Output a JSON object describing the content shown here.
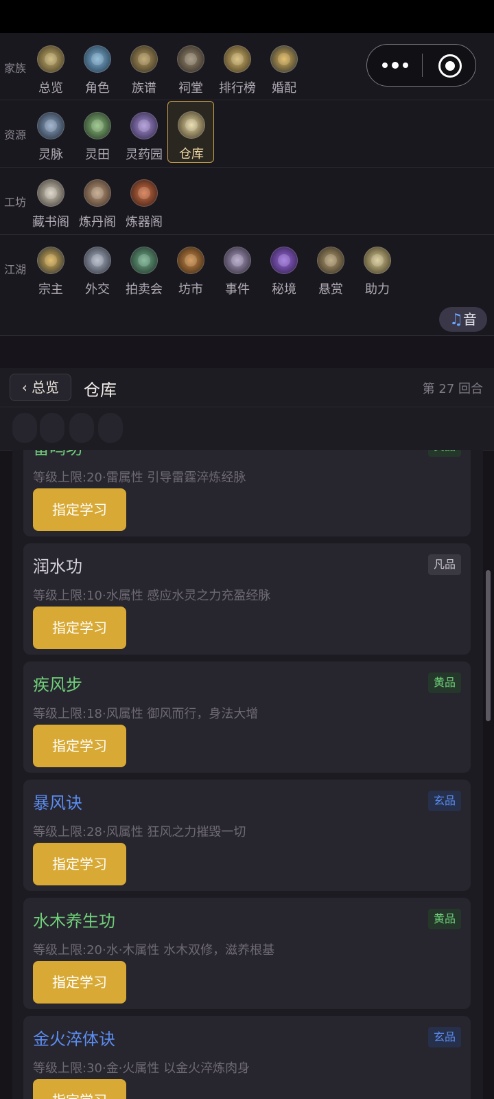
{
  "menu": {
    "rows": [
      {
        "label": "家族",
        "items": [
          "总览",
          "角色",
          "族谱",
          "祠堂",
          "排行榜",
          "婚配"
        ]
      },
      {
        "label": "资源",
        "items": [
          "灵脉",
          "灵田",
          "灵药园",
          "仓库"
        ]
      },
      {
        "label": "工坊",
        "items": [
          "藏书阁",
          "炼丹阁",
          "炼器阁"
        ]
      },
      {
        "label": "江湖",
        "items": [
          "宗主",
          "外交",
          "拍卖会",
          "坊市",
          "事件",
          "秘境",
          "悬赏",
          "助力"
        ]
      }
    ],
    "active_item": "仓库",
    "music_label": "音",
    "music_icon": "music-note-icon"
  },
  "header": {
    "back_label": "‹ 总览",
    "title": "仓库",
    "round": "第 27 回合"
  },
  "learn_label": "指定学习",
  "grade_colors": {
    "凡品": {
      "text": "#c9c5cf",
      "bg": "#3a3840",
      "name": "#d7d3dc"
    },
    "黄品": {
      "text": "#6fcf7a",
      "bg": "#25372a",
      "name": "#6fcf7a"
    },
    "玄品": {
      "text": "#5b8df2",
      "bg": "#26304a",
      "name": "#5b8df2"
    }
  },
  "techniques": [
    {
      "name": "雷鸣功",
      "grade": "黄品",
      "desc": "等级上限:20·雷属性  引导雷霆淬炼经脉"
    },
    {
      "name": "润水功",
      "grade": "凡品",
      "desc": "等级上限:10·水属性  感应水灵之力充盈经脉"
    },
    {
      "name": "疾风步",
      "grade": "黄品",
      "desc": "等级上限:18·风属性  御风而行，身法大增"
    },
    {
      "name": "暴风诀",
      "grade": "玄品",
      "desc": "等级上限:28·风属性  狂风之力摧毁一切"
    },
    {
      "name": "水木养生功",
      "grade": "黄品",
      "desc": "等级上限:20·水·木属性  水木双修，滋养根基"
    },
    {
      "name": "金火淬体诀",
      "grade": "玄品",
      "desc": "等级上限:30·金·火属性  以金火淬炼肉身"
    }
  ]
}
